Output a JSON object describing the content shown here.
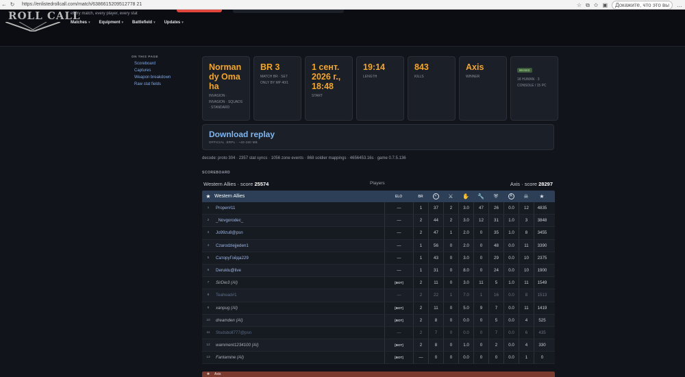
{
  "browser": {
    "url": "https://enlistedrollcall.com/match/6386615209512778 21",
    "profile_label": "Докажите, что это вы"
  },
  "site": {
    "logo_text": "ROLL CALL",
    "tagline": "every match, every player, every stat",
    "nav": [
      "Matches",
      "Equipment",
      "Battlefield",
      "Updates"
    ]
  },
  "sidebar": {
    "heading": "ON THIS PAGE",
    "links": [
      "Scoreboard",
      "Captures",
      "Weapon breakdown",
      "Raw stat fields"
    ]
  },
  "cards": [
    {
      "value": "Normandy Omaha",
      "sub": "INVASION · INVASION · SQUADS · STANDARD"
    },
    {
      "value": "BR 3",
      "sub": "MATCH BR · SET ONLY BY MP 40/1"
    },
    {
      "value": "1 сент. 2026 г., 18:48",
      "sub": "START"
    },
    {
      "value": "19:14",
      "sub": "LENGTH"
    },
    {
      "value": "843",
      "sub": "KILLS"
    },
    {
      "value": "Axis",
      "sub": "WINNER"
    },
    {
      "badge": "MIXED",
      "sub": "18 HUMAN · 3 CONSOLE / 15 PC"
    }
  ],
  "replay": {
    "title": "Download replay",
    "sub": "OFFICIAL .ERPL · ~40-180 MB"
  },
  "decode_line": "decode: proto 304 · 2357 stat syncs · 1056 zone events · 868 soldier mappings · 4656453.16s · game 0.7.5.136",
  "scoreboard": {
    "heading": "SCOREBOARD",
    "allies_label": "Western Allies · score",
    "allies_score": "25574",
    "players_label": "Players",
    "axis_label": "Axis · score",
    "axis_score": "28297",
    "team_name": "Western Allies",
    "col_elo": "ELO",
    "col_br": "BR",
    "axis_team_name": "Axis",
    "rows": [
      {
        "idx": "1",
        "name": "Proper#11",
        "elo": "—",
        "br": "1",
        "v": [
          "37",
          "2",
          "3.0",
          "47",
          "26",
          "0.0",
          "12",
          "4835"
        ],
        "bot": false,
        "dim": false
      },
      {
        "idx": "2",
        "name": "_Novgorodec_",
        "elo": "—",
        "br": "2",
        "v": [
          "44",
          "2",
          "3.0",
          "12",
          "31",
          "1.0",
          "3",
          "3848"
        ],
        "bot": false,
        "dim": false
      },
      {
        "idx": "3",
        "name": "Jo99zu8@psn",
        "elo": "—",
        "br": "2",
        "v": [
          "47",
          "1",
          "2.0",
          "0",
          "35",
          "1.0",
          "8",
          "3455"
        ],
        "bot": false,
        "dim": false
      },
      {
        "idx": "4",
        "name": "Czarodziejjeden1",
        "elo": "—",
        "br": "1",
        "v": [
          "56",
          "0",
          "2.0",
          "0",
          "48",
          "0.0",
          "11",
          "3390"
        ],
        "bot": false,
        "dim": false
      },
      {
        "idx": "5",
        "name": "СатоpуГойда229",
        "elo": "—",
        "br": "1",
        "v": [
          "43",
          "0",
          "3.0",
          "0",
          "29",
          "0.0",
          "10",
          "2375"
        ],
        "bot": false,
        "dim": false
      },
      {
        "idx": "6",
        "name": "Deruklu@live",
        "elo": "—",
        "br": "1",
        "v": [
          "31",
          "0",
          "8.0",
          "0",
          "24",
          "0.0",
          "10",
          "1900"
        ],
        "bot": false,
        "dim": false
      },
      {
        "idx": "7",
        "name": "SirDie3 (AI)",
        "elo": "[BOT]",
        "br": "2",
        "v": [
          "11",
          "0",
          "3.0",
          "11",
          "5",
          "1.0",
          "11",
          "1549"
        ],
        "bot": true,
        "dim": false
      },
      {
        "idx": "8",
        "name": "Teahead#1",
        "elo": "—",
        "br": "2",
        "v": [
          "22",
          "1",
          "7.0",
          "1",
          "16",
          "0.0",
          "8",
          "1513"
        ],
        "bot": false,
        "dim": true
      },
      {
        "idx": "9",
        "name": "xanpug (AI)",
        "elo": "[BOT]",
        "br": "2",
        "v": [
          "11",
          "0",
          "5.0",
          "9",
          "7",
          "0.0",
          "11",
          "1419"
        ],
        "bot": true,
        "dim": false
      },
      {
        "idx": "10",
        "name": "dreamden (AI)",
        "elo": "[BOT]",
        "br": "2",
        "v": [
          "8",
          "0",
          "0.0",
          "0",
          "5",
          "0.0",
          "4",
          "525"
        ],
        "bot": true,
        "dim": false
      },
      {
        "idx": "11",
        "name": "Studsboll777@psn",
        "elo": "—",
        "br": "2",
        "v": [
          "7",
          "0",
          "0.0",
          "0",
          "7",
          "0.0",
          "6",
          "435"
        ],
        "bot": false,
        "dim": true
      },
      {
        "idx": "12",
        "name": "wamment1234100 (AI)",
        "elo": "[BOT]",
        "br": "2",
        "v": [
          "8",
          "0",
          "1.0",
          "0",
          "2",
          "0.0",
          "4",
          "330"
        ],
        "bot": true,
        "dim": false
      },
      {
        "idx": "13",
        "name": "Fantamine (AI)",
        "elo": "[BOT]",
        "br": "—",
        "v": [
          "0",
          "0",
          "0.0",
          "0",
          "0",
          "0.0",
          "1",
          "0"
        ],
        "bot": true,
        "dim": false
      }
    ]
  },
  "icons": [
    "crosshair-icon",
    "knife-icon",
    "hand-icon",
    "wrench-icon",
    "shield-icon",
    "a-circle-icon",
    "skull-icon",
    "star-icon"
  ]
}
